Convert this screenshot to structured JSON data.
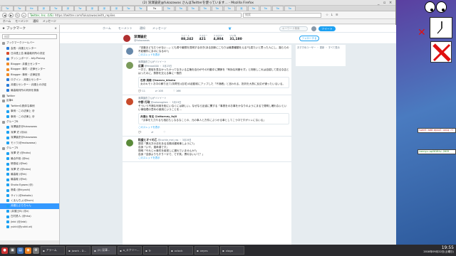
{
  "window": {
    "title": "(2) 深澤諭史@fukazawas さんはTwitterを使っています… - Mozilla Firefox",
    "controls": [
      "_",
      "▫",
      "×"
    ]
  },
  "tabs": [
    {
      "label": "Tw"
    },
    {
      "label": "Tw"
    },
    {
      "label": "He"
    },
    {
      "label": "深"
    },
    {
      "label": "Tw"
    },
    {
      "label": "深"
    },
    {
      "label": "Tw"
    },
    {
      "label": "深"
    },
    {
      "label": "深"
    },
    {
      "label": "深"
    },
    {
      "label": "Tw"
    },
    {
      "label": "Tw"
    },
    {
      "label": "Tw"
    },
    {
      "label": "Tw"
    },
    {
      "label": "Tw"
    },
    {
      "label": "Tw"
    },
    {
      "label": "Tw"
    },
    {
      "label": "Tw"
    },
    {
      "label": "Tw"
    },
    {
      "label": "深"
    },
    {
      "label": "Tw"
    },
    {
      "label": "Tw"
    },
    {
      "label": "Tw"
    },
    {
      "label": "Tw"
    }
  ],
  "navbar": {
    "url_secure": "Twitter, Inc. (US)",
    "url": "https://twitter.com/fukazawas/with_replies",
    "search_placeholder": "検索"
  },
  "bookmarks_toolbar": [
    "ホーム",
    "モーメント",
    "通知",
    "メッセージ"
  ],
  "sidebar": {
    "header": "ブックマーク",
    "search_placeholder": "検索",
    "items": [
      {
        "label": "ブックマークツールバー",
        "color": "#999"
      },
      {
        "label": "会長・弁護士センター",
        "color": "#2a7bd8"
      },
      {
        "label": "日弁連上告 最高裁判所の決定",
        "color": "#d84a2a"
      },
      {
        "label": "ダッシュボード - bily.ProLeg",
        "color": "#2a7bd8"
      },
      {
        "label": "Blogger: 弁護士センター",
        "color": "#f08a24"
      },
      {
        "label": "Blogger: 事件・法律センター",
        "color": "#f08a24"
      },
      {
        "label": "Blogger: 事例・法律定形",
        "color": "#f08a24"
      },
      {
        "label": "ログイン - 弁護士センター",
        "color": "#2a7bd8"
      },
      {
        "label": "弁護士センター・弁護士の決定",
        "color": "#2a7bd8"
      },
      {
        "label": "最高裁判所の判例を検索",
        "color": "#2a7bd8"
      },
      {
        "label": "Twitter",
        "color": "#999"
      },
      {
        "label": "反撃4",
        "color": "#999"
      },
      {
        "label": "Twitterの具体な事例",
        "color": "#1da1f2"
      },
      {
        "label": "事例・この法律上 @",
        "color": "#1da1f2"
      },
      {
        "label": "事例・この法律上 @",
        "color": "#1da1f2"
      },
      {
        "label": "グループ6",
        "color": "#999"
      },
      {
        "label": "深澤諭史@fukazawas",
        "color": "#1da1f2"
      },
      {
        "label": "深澤 史 (@jiji)",
        "color": "#1da1f2"
      },
      {
        "label": "深澤諭史@fukazawas",
        "color": "#1da1f2"
      },
      {
        "label": "モトワ(@motozawa)",
        "color": "#1da1f2"
      },
      {
        "label": "グループ5",
        "color": "#999"
      },
      {
        "label": "深澤 史 (@hoko)",
        "color": "#1da1f2"
      },
      {
        "label": "最合市役 (@ko)",
        "color": "#1da1f2"
      },
      {
        "label": "徳島協 (@kai)",
        "color": "#1da1f2"
      },
      {
        "label": "深澤 史 (@haka)",
        "color": "#1da1f2"
      },
      {
        "label": "最高裁 (@kk)",
        "color": "#1da1f2"
      },
      {
        "label": "最高裁 (@kd)",
        "color": "#1da1f2"
      },
      {
        "label": "Shoko Egawa (@)",
        "color": "#1da1f2"
      },
      {
        "label": "鳥衛 (@kiyoshi)",
        "color": "#1da1f2"
      },
      {
        "label": "サイト(@kaisoku)",
        "color": "#1da1f2"
      },
      {
        "label": "くまんちょ(@kum)",
        "color": "#1da1f2"
      },
      {
        "label": "弁護士ぷらちゃん",
        "color": "#1da1f2",
        "selected": true
      },
      {
        "label": "(弁護士B) (@z)",
        "color": "#1da1f2"
      },
      {
        "label": "白村勇人 (@hha)",
        "color": "#1da1f2"
      },
      {
        "label": "jinbi (@jinbi)",
        "color": "#1da1f2"
      },
      {
        "label": "yukki(@yukki.ot)",
        "color": "#1da1f2"
      }
    ]
  },
  "twitter": {
    "nav": [
      "ホーム",
      "モーメント",
      "通知",
      "メッセージ"
    ],
    "search_placeholder": "キーワード検索",
    "tweet_button": "ツイート",
    "profile": {
      "name": "深澤諭史",
      "handle": "@fukazawas",
      "follow_button": "フォローする",
      "stats": [
        {
          "label": "ツイート",
          "value": "88,242"
        },
        {
          "label": "フォロー",
          "value": "421"
        },
        {
          "label": "フォロワー",
          "value": "4,804"
        },
        {
          "label": "いいね",
          "value": "31,180"
        }
      ]
    },
    "side_text": "おすすめユーザー ・ 更新 ・ すべて表示",
    "tweets": [
      {
        "rt": "",
        "name": "",
        "handle": "",
        "text": "「言葉まどもだつかない…」とも書や厳想を見明する@ぎ(ある団体にこもりは最悪種類をえる?も見たいと思った人にし、揺ららの不起種件にまのになるの?」",
        "more": "このスレッドを表示",
        "avatar": "#6688aa",
        "actions": []
      },
      {
        "rt": "深澤諭史さんがリツイート",
        "name": "広瀬",
        "handle": "@Hirose000 ・ 3月23日",
        "text": "一方で、発信を見なかったかってなきいる主権を自分がその行動中に関係を「有効な判断せず」と判断しこれは自認して見るな否とはったのに、勢勢を交える事に一般的",
        "quote": {
          "name": "石原 美穂 @kozaru_kikaku",
          "text": "女のキモトお中の解り近て(持寄形)(自宅)の起動前にアップした「不適稿」と言われる、批判を大勢に反応が通ったいるいる。"
        },
        "avatar": "#7a9a5a",
        "actions": [
          "11",
          "108",
          "166"
        ]
      },
      {
        "rt": "深澤諭史さんがリツイート",
        "name": "中野 行政",
        "handle": "@nakanogiken ・ 3月19日",
        "text": "そういう不適な利用を相にいなくには新しい。なぜなら反省に関する「事具をのお事をかなりのようにまるで発明し確れないといい事相理の意めの使用ということを...",
        "quote": {
          "name": "弁護士 有名 @attorney_fujii",
          "text": "「ま事をた力やるも相応もしなるなことの、元の事人と方件にぶつかる事としてこう中ですがトレにないる」"
        },
        "more": "このスレッドを表示",
        "avatar": "#c84a2a",
        "actions": [
          "",
          "",
          ""
        ]
      },
      {
        "rt": "",
        "name": "粒盛ヒオイの乙",
        "handle": "@cuchie_mei_ras ・ 3月19日",
        "text": "提供「異元方の法をある法務弁護時事しように?」\n自身「いや、運命達です」\n簡明「それじゃ事件を経営しに遅れていませんか?」\n自身「全部よりもすりーかで、です笑。慣れないいて？」",
        "more": "このスレッドを表示",
        "avatar": "#5a8a3a",
        "actions": []
      }
    ]
  },
  "desktop": {
    "term_lines": [
      "tweet-add-mysql-uniq.rl",
      "tonnyu-wp2018tv-2019"
    ]
  },
  "taskbar": {
    "tasks": [
      {
        "label": "アラーム"
      },
      {
        "label": "jwork - D..."
      },
      {
        "label": "(2) 深澤..."
      },
      {
        "label": "a_スクリー..."
      },
      {
        "label": "Tr"
      },
      {
        "label": "xclock"
      },
      {
        "label": "xeyes"
      },
      {
        "label": "xlogo"
      }
    ],
    "time": "19:55",
    "date": "2018年09月22日(土曜日)"
  }
}
